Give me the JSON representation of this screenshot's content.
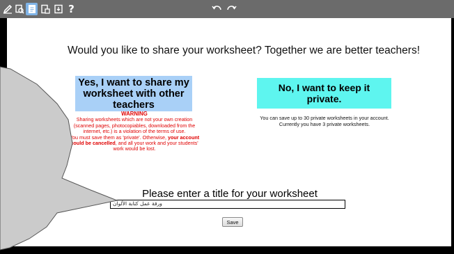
{
  "toolbar": {
    "icons": [
      "edit-icon",
      "preview-icon",
      "save-document-icon",
      "save-as-icon",
      "export-icon",
      "help-icon",
      "undo-icon",
      "redo-icon"
    ],
    "help_label": "?"
  },
  "headline": "Would you like to share your worksheet? Together we are better teachers!",
  "share_option": {
    "label": "Yes, I want to share my worksheet with other teachers",
    "color": "#a9d0f7"
  },
  "warning": {
    "title": "WARNING",
    "line1": "Sharing worksheets which are not your own creation (scanned pages, photocopiables, downloaded from the internet, etc.) is a violation of the terms of use.",
    "line2_start": "You must save them as 'private'. Otherwise, ",
    "line2_bold": "your account could be cancelled",
    "line2_end": ", and all your work and your students' work would be lost.",
    "color": "#e00000"
  },
  "private_option": {
    "label": "No, I want to keep it private.",
    "color": "#5ef5ef",
    "info_line1": "You can save up to 30 private worksheets in your account.",
    "info_line2": "Currently you have 3 private worksheets."
  },
  "title_prompt": "Please enter a title for your worksheet",
  "title_field": {
    "value": "ورقة عمل كتابة الألوان"
  },
  "save_label": "Save"
}
